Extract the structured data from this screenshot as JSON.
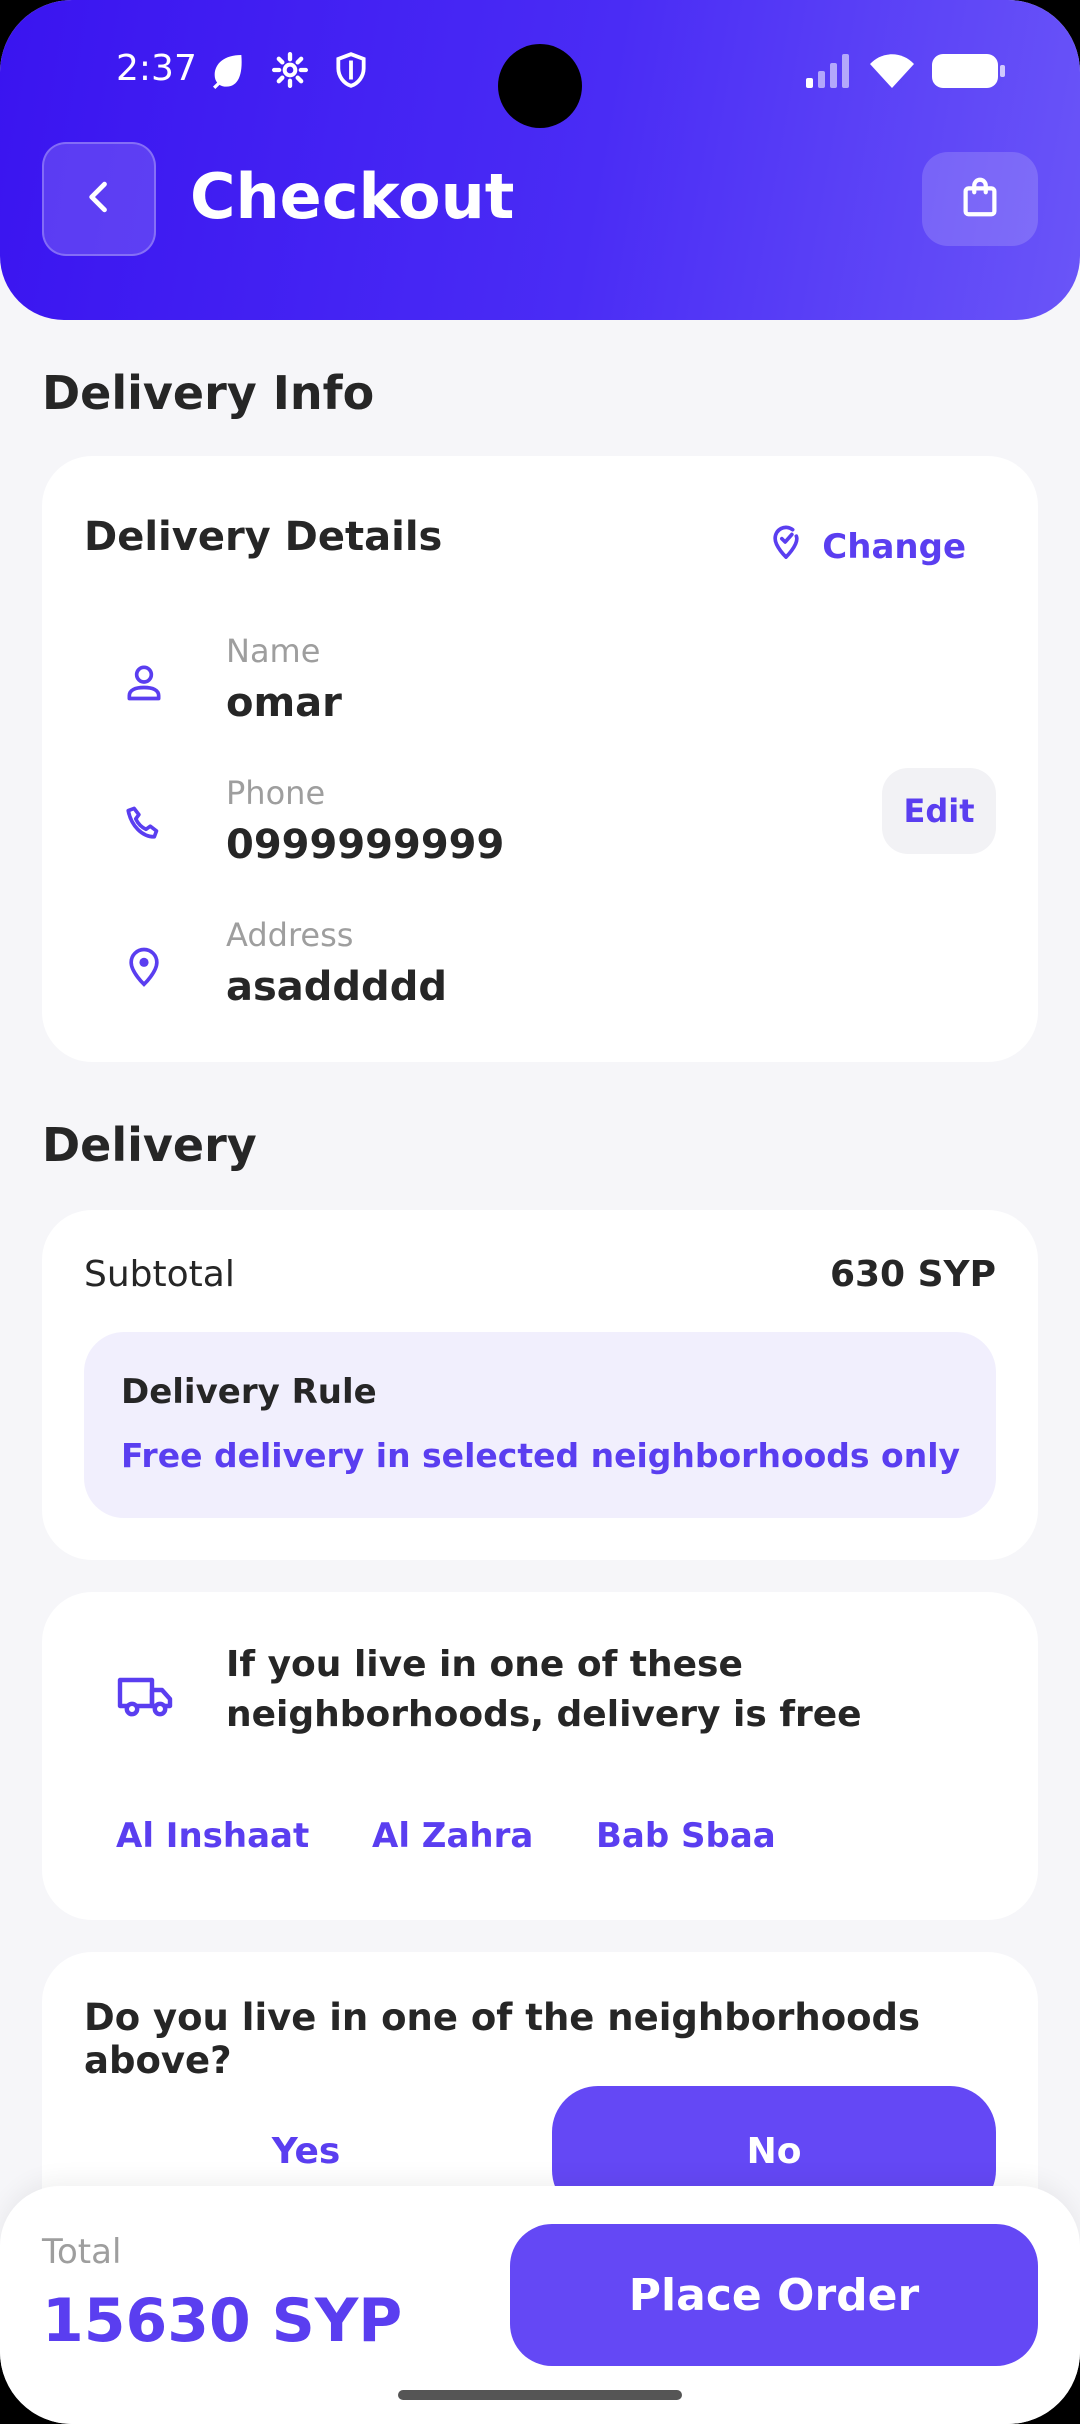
{
  "status_bar": {
    "time": "2:37",
    "icons_left": [
      "leaf-icon",
      "gear-icon",
      "shield-icon"
    ],
    "icons_right": [
      "signal-icon",
      "wifi-icon",
      "battery-icon"
    ]
  },
  "header": {
    "title": "Checkout",
    "back_icon": "chevron-left-icon",
    "cart_icon": "shopping-bag-icon"
  },
  "delivery_info": {
    "section_title": "Delivery Info",
    "card_title": "Delivery Details",
    "change_label": "Change",
    "edit_label": "Edit",
    "rows": [
      {
        "icon": "person-icon",
        "label": "Name",
        "value": "omar"
      },
      {
        "icon": "phone-icon",
        "label": "Phone",
        "value": "0999999999"
      },
      {
        "icon": "location-pin-icon",
        "label": "Address",
        "value": "asaddddd"
      }
    ]
  },
  "delivery": {
    "section_title": "Delivery",
    "subtotal_label": "Subtotal",
    "subtotal_value": "630 SYP",
    "rule_title": "Delivery Rule",
    "rule_text": "Free delivery in selected neighborhoods only"
  },
  "neighborhoods": {
    "icon": "truck-icon",
    "text": "If you live in one of these neighborhoods, delivery is free",
    "items": [
      "Al Inshaat",
      "Al Zahra",
      "Bab Sbaa"
    ]
  },
  "question": {
    "text": "Do you live in one of the neighborhoods above?",
    "yes_label": "Yes",
    "no_label": "No",
    "selected": "No"
  },
  "footer": {
    "total_label": "Total",
    "total_value": "15630 SYP",
    "place_order_label": "Place Order"
  },
  "colors": {
    "primary": "#6448F5",
    "header_start": "#3A14F0",
    "text_accent": "#5A3EF0",
    "background": "#F6F6F9"
  }
}
